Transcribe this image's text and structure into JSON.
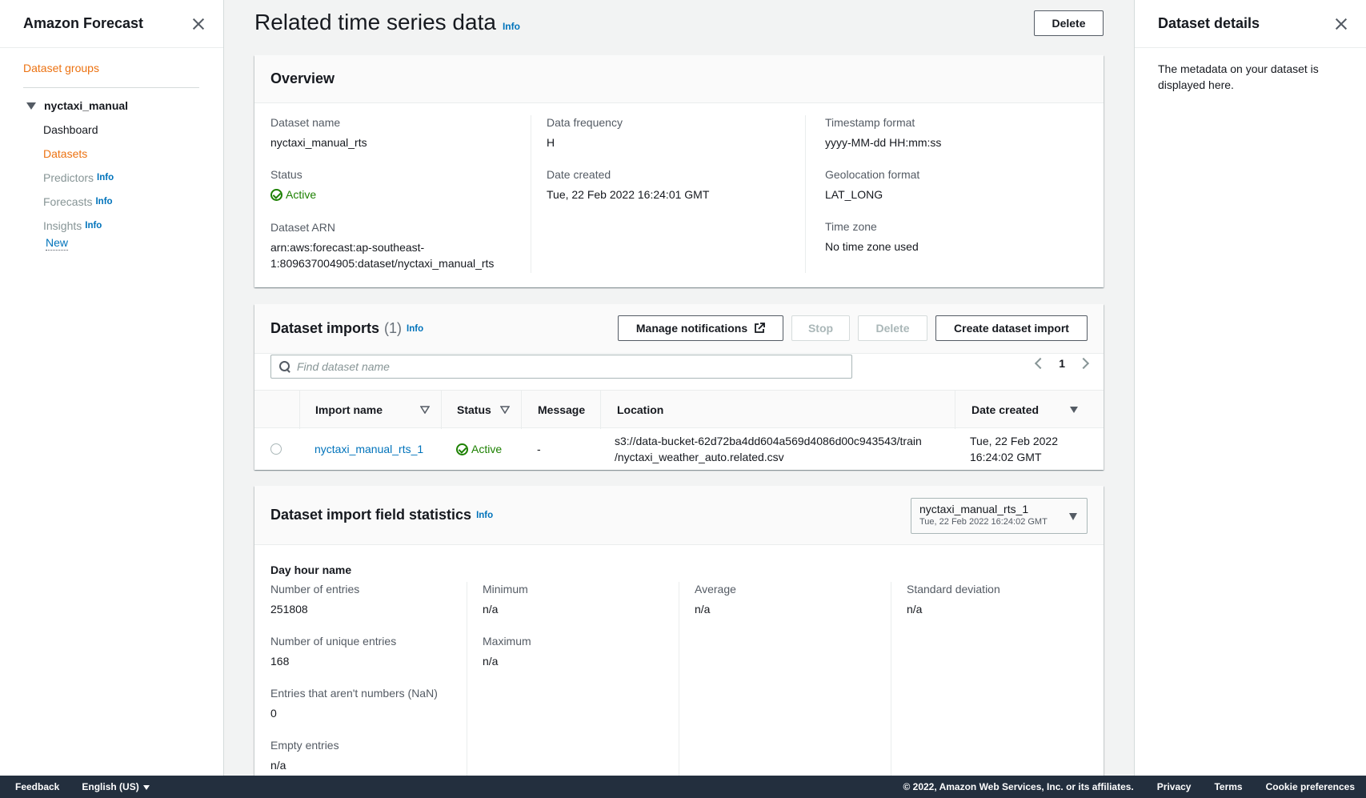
{
  "leftnav": {
    "title": "Amazon Forecast",
    "dataset_groups": "Dataset groups",
    "group_name": "nyctaxi_manual",
    "items": [
      {
        "label": "Dashboard",
        "info": ""
      },
      {
        "label": "Datasets",
        "info": ""
      },
      {
        "label": "Predictors",
        "info": "Info"
      },
      {
        "label": "Forecasts",
        "info": "Info"
      },
      {
        "label": "Insights",
        "info": "Info"
      }
    ],
    "new_badge": "New"
  },
  "page": {
    "title": "Related time series data",
    "info": "Info",
    "delete_label": "Delete"
  },
  "overview": {
    "heading": "Overview",
    "dataset_name_label": "Dataset name",
    "dataset_name": "nyctaxi_manual_rts",
    "status_label": "Status",
    "status": "Active",
    "arn_label": "Dataset ARN",
    "arn_line1": "arn:aws:forecast:ap-southeast-",
    "arn_line2": "1:809637004905:dataset/nyctaxi_manual_rts",
    "frequency_label": "Data frequency",
    "frequency": "H",
    "date_created_label": "Date created",
    "date_created": "Tue, 22 Feb 2022 16:24:01 GMT",
    "timestamp_label": "Timestamp format",
    "timestamp": "yyyy-MM-dd HH:mm:ss",
    "geo_label": "Geolocation format",
    "geo": "LAT_LONG",
    "tz_label": "Time zone",
    "tz": "No time zone used"
  },
  "imports": {
    "heading": "Dataset imports",
    "count": "(1)",
    "info": "Info",
    "manage_label": "Manage notifications",
    "stop_label": "Stop",
    "delete_label": "Delete",
    "create_label": "Create dataset import",
    "search_placeholder": "Find dataset name",
    "page": "1",
    "columns": [
      "Import name",
      "Status",
      "Message",
      "Location",
      "Date created"
    ],
    "rows": [
      {
        "name": "nyctaxi_manual_rts_1",
        "status": "Active",
        "message": "-",
        "location_line1": "s3://data-bucket-62d72ba4dd604a569d4086d00c943543/train",
        "location_line2": "/nyctaxi_weather_auto.related.csv",
        "date_line1": "Tue, 22 Feb 2022",
        "date_line2": "16:24:02 GMT"
      }
    ]
  },
  "stats": {
    "heading": "Dataset import field statistics",
    "info": "Info",
    "select_name": "nyctaxi_manual_rts_1",
    "select_date": "Tue, 22 Feb 2022 16:24:02 GMT",
    "field_title": "Day hour name",
    "entries_label": "Number of entries",
    "entries": "251808",
    "unique_label": "Number of unique entries",
    "unique": "168",
    "nan_label": "Entries that aren't numbers (NaN)",
    "nan": "0",
    "empty_label": "Empty entries",
    "empty": "n/a",
    "min_label": "Minimum",
    "min": "n/a",
    "max_label": "Maximum",
    "max": "n/a",
    "avg_label": "Average",
    "avg": "n/a",
    "std_label": "Standard deviation",
    "std": "n/a"
  },
  "rightpanel": {
    "title": "Dataset details",
    "body": "The metadata on your dataset is displayed here."
  },
  "footer": {
    "feedback": "Feedback",
    "language": "English (US)",
    "copyright": "© 2022, Amazon Web Services, Inc. or its affiliates.",
    "privacy": "Privacy",
    "terms": "Terms",
    "cookies": "Cookie preferences"
  },
  "colors": {
    "accent_orange": "#ec7211",
    "link_blue": "#0073bb",
    "success_green": "#1d8102",
    "footer_bg": "#232f3e"
  }
}
